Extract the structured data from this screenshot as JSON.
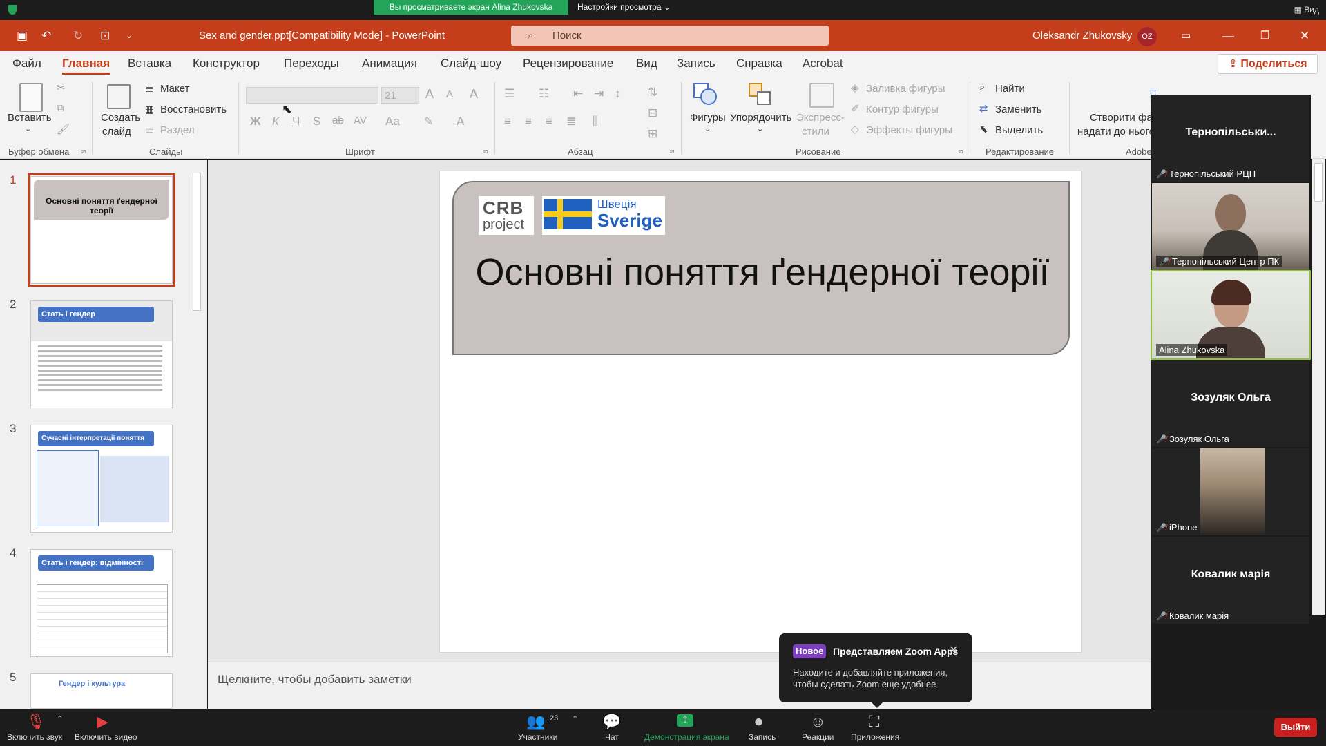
{
  "zoom_top": {
    "share_banner": "Вы просматриваете экран Alina Zhukovska",
    "view_options": "Настройки просмотра ⌄",
    "view_button": "▦ Вид"
  },
  "ppt_titlebar": {
    "title": "Sex and gender.ppt[Compatibility Mode]  -  PowerPoint",
    "search_placeholder": "Поиск",
    "user_name": "Oleksandr Zhukovsky",
    "user_initials": "OZ"
  },
  "menu": {
    "tabs": [
      "Файл",
      "Главная",
      "Вставка",
      "Конструктор",
      "Переходы",
      "Анимация",
      "Слайд-шоу",
      "Рецензирование",
      "Вид",
      "Запись",
      "Справка",
      "Acrobat"
    ],
    "active_tab": "Главная",
    "share": "Поделиться"
  },
  "ribbon": {
    "clipboard": {
      "paste": "Вставить",
      "label": "Буфер обмена"
    },
    "slides": {
      "create": "Создать",
      "create2": "слайд",
      "layout": "Макет",
      "reset": "Восстановить",
      "section": "Раздел",
      "label": "Слайды"
    },
    "font": {
      "size": "21",
      "label": "Шрифт",
      "bold": "Ж",
      "italic": "К",
      "underline": "Ч",
      "strike": "S",
      "case": "Аа"
    },
    "paragraph": {
      "label": "Абзац"
    },
    "drawing": {
      "shapes": "Фигуры",
      "arrange": "Упорядочить",
      "quick_styles": "Экспресс-",
      "quick_styles2": "стили",
      "fill": "Заливка фигуры",
      "outline": "Контур фигуры",
      "effects": "Эффекты фигуры",
      "label": "Рисование"
    },
    "editing": {
      "find": "Найти",
      "replace": "Заменить",
      "select": "Выделить",
      "label": "Редактирование"
    },
    "adobe": {
      "create": "Створити фа",
      "create2": "надати до нього",
      "label": "Adobe"
    }
  },
  "thumbnails": [
    {
      "num": "1",
      "title": "Основні поняття ґендерної теорії"
    },
    {
      "num": "2",
      "title": "Стать і гендер"
    },
    {
      "num": "3",
      "title": "Сучасні інтерпретації поняття «гендер»"
    },
    {
      "num": "4",
      "title": "Стать і гендер: відмінності"
    },
    {
      "num": "5",
      "title": "Гендер і культура"
    }
  ],
  "slide": {
    "crb_top": "CRB",
    "crb_bottom": "project",
    "sweden_ua": "Швеція",
    "sweden_sv": "Sverige",
    "title": "Основні поняття ґендерної теорії"
  },
  "notes_placeholder": "Щелкните, чтобы добавить заметки",
  "gallery": [
    {
      "big": "Тернопільськи...",
      "name": "Тернопільський РЦП"
    },
    {
      "big": "",
      "name": "Тернопільський Центр ПК"
    },
    {
      "big": "",
      "name": "Alina Zhukovska"
    },
    {
      "big": "Зозуляк Ольга",
      "name": "Зозуляк Ольга"
    },
    {
      "big": "",
      "name": "iPhone"
    },
    {
      "big": "Ковалик марія",
      "name": "Ковалик марія"
    }
  ],
  "popup": {
    "badge": "Новое",
    "title": "Представляем Zoom Apps",
    "body": "Находите и добавляйте приложения, чтобы сделать Zoom еще удобнее"
  },
  "zoom_bottom": {
    "audio": "Включить звук",
    "video": "Включить видео",
    "participants": "Участники",
    "participants_count": "23",
    "chat": "Чат",
    "share": "Демонстрация экрана",
    "record": "Запись",
    "reactions": "Реакции",
    "apps": "Приложения",
    "leave": "Выйти"
  },
  "colors": {
    "ppt_accent": "#c43e1c",
    "zoom_green": "#23a559",
    "leave_red": "#c81f1f"
  }
}
